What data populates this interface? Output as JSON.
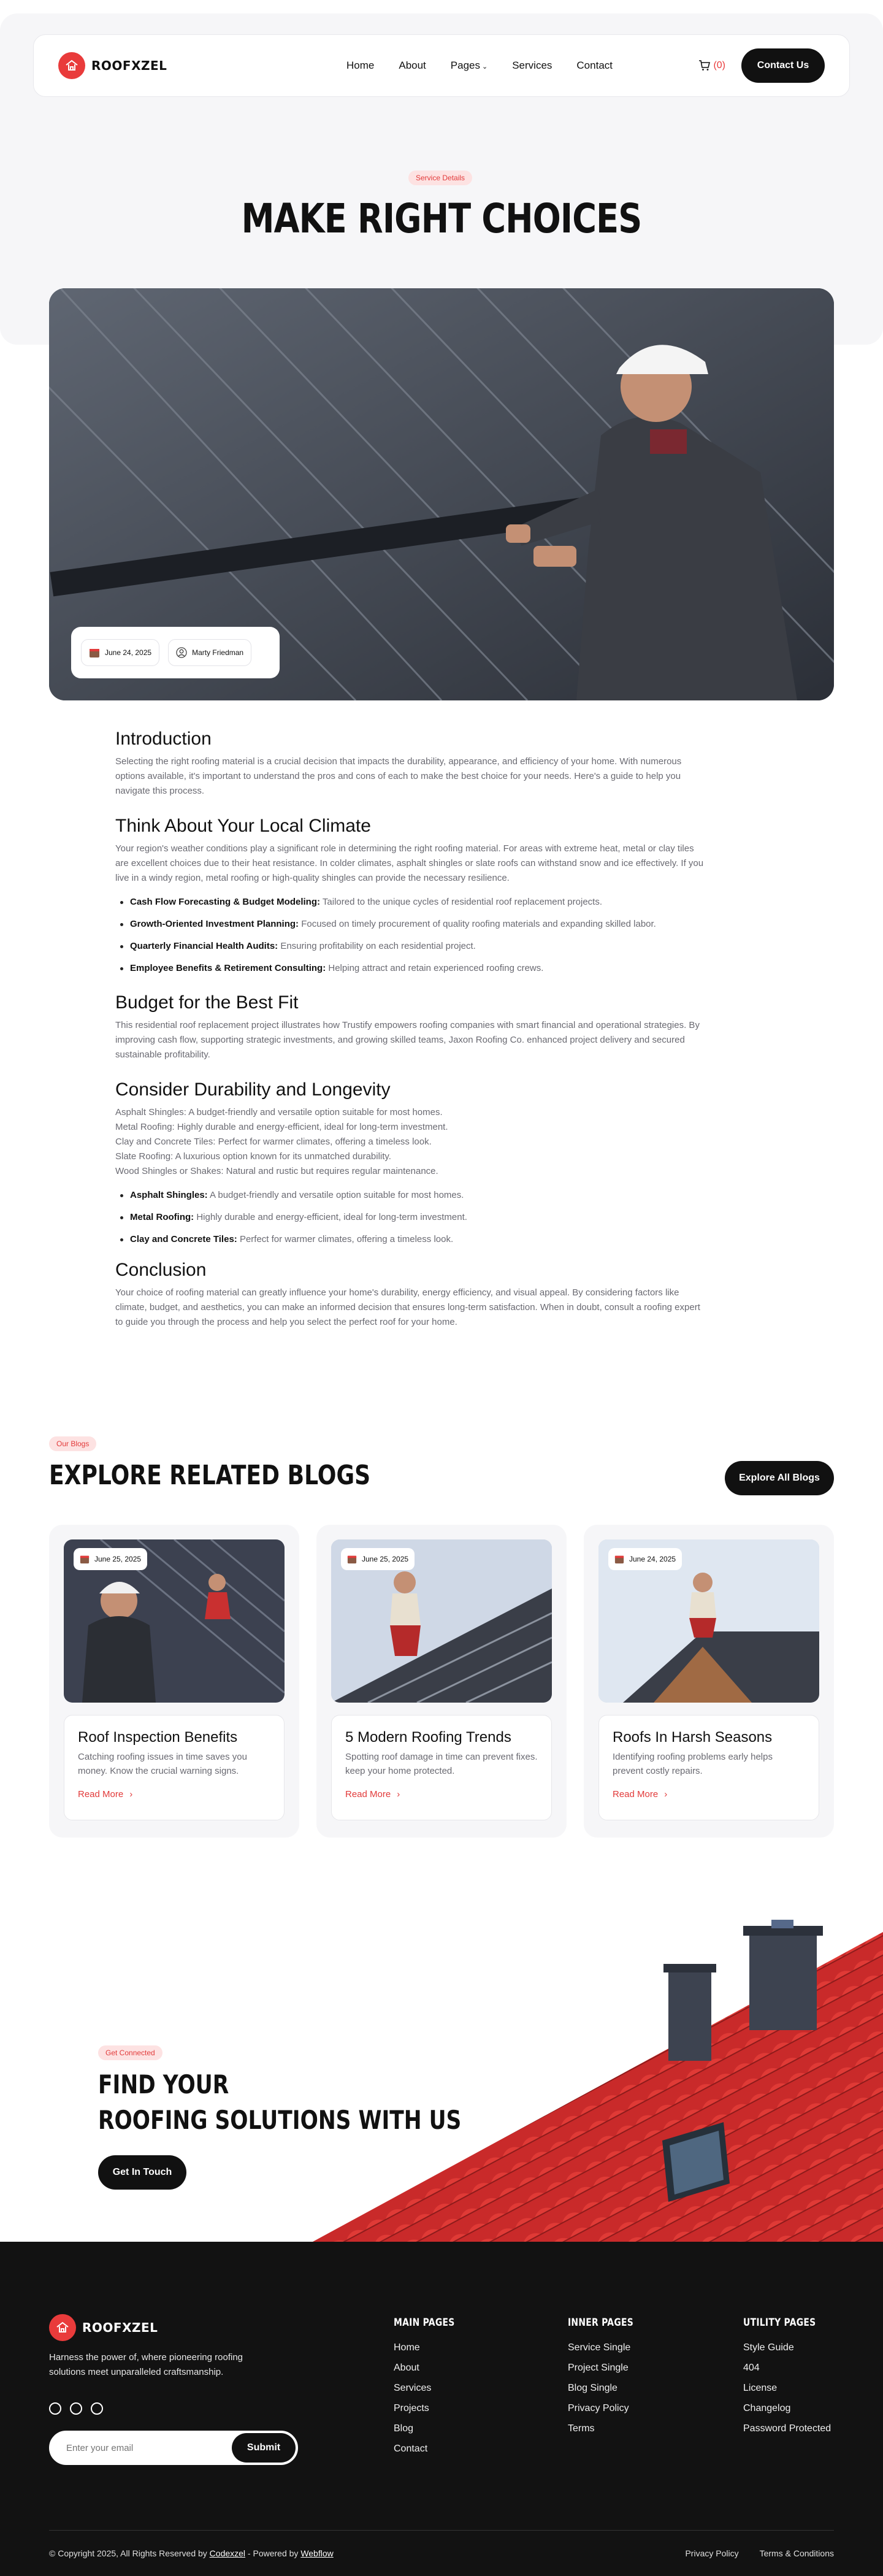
{
  "brand": {
    "name": "ROOFXZEL",
    "accent": "#e93b3b"
  },
  "nav": {
    "links": [
      "Home",
      "About",
      "Pages",
      "Services",
      "Contact"
    ],
    "cart_count": "(0)",
    "contact_label": "Contact Us"
  },
  "hero": {
    "pill": "Service Details",
    "title": "MAKE RIGHT CHOICES",
    "date": "June 24, 2025",
    "author": "Marty Friedman"
  },
  "article": {
    "intro_h": "Introduction",
    "intro_p": "Selecting the right roofing material is a crucial decision that impacts the durability, appearance, and efficiency of your home. With numerous options available, it's important to understand the pros and cons of each to make the best choice for your needs. Here's a guide to help you navigate this process.",
    "climate_h": "Think About Your Local Climate",
    "climate_p": "Your region's weather conditions play a significant role in determining the right roofing material. For areas with extreme heat, metal or clay tiles are excellent choices due to their heat resistance. In colder climates, asphalt shingles or slate roofs can withstand snow and ice effectively. If you live in a windy region, metal roofing or high-quality shingles can provide the necessary resilience.",
    "climate_list": [
      {
        "b": "Cash Flow Forecasting & Budget Modeling:",
        "t": " Tailored to the unique cycles of residential roof replacement projects."
      },
      {
        "b": "Growth-Oriented Investment Planning:",
        "t": " Focused on timely procurement of quality roofing materials and expanding skilled labor."
      },
      {
        "b": "Quarterly Financial Health Audits:",
        "t": " Ensuring profitability on each residential project."
      },
      {
        "b": "Employee Benefits & Retirement Consulting:",
        "t": " Helping attract and retain experienced roofing crews."
      }
    ],
    "budget_h": "Budget for the Best Fit",
    "budget_p": "This residential roof replacement project illustrates how Trustify empowers roofing companies with smart financial and operational strategies. By improving cash flow, supporting strategic investments, and growing skilled teams, Jaxon Roofing Co. enhanced project delivery and secured sustainable profitability.",
    "durability_h": "Consider Durability and Longevity",
    "durability_lines": [
      "Asphalt Shingles: A budget-friendly and versatile option suitable for most homes.",
      "Metal Roofing: Highly durable and energy-efficient, ideal for long-term investment.",
      "Clay and Concrete Tiles: Perfect for warmer climates, offering a timeless look.",
      "Slate Roofing: A luxurious option known for its unmatched durability.",
      "Wood Shingles or Shakes: Natural and rustic but requires regular maintenance."
    ],
    "durability_list": [
      {
        "b": "Asphalt Shingles:",
        "t": " A budget-friendly and versatile option suitable for most homes."
      },
      {
        "b": "Metal Roofing:",
        "t": " Highly durable and energy-efficient, ideal for long-term investment."
      },
      {
        "b": "Clay and Concrete Tiles:",
        "t": " Perfect for warmer climates, offering a timeless look."
      }
    ],
    "conclusion_h": "Conclusion",
    "conclusion_p": "Your choice of roofing material can greatly influence your home's durability, energy efficiency, and visual appeal. By considering factors like climate, budget, and aesthetics, you can make an informed decision that ensures long-term satisfaction. When in doubt, consult a roofing expert to guide you through the process and help you select the perfect roof for your home."
  },
  "blogs": {
    "pill": "Our Blogs",
    "title": "EXPLORE RELATED BLOGS",
    "all_label": "Explore All Blogs",
    "read_more": "Read More",
    "items": [
      {
        "date": "June 25, 2025",
        "title": "Roof Inspection Benefits",
        "desc": "Catching roofing issues in time saves you money. Know the crucial warning signs."
      },
      {
        "date": "June 25, 2025",
        "title": "5 Modern Roofing Trends",
        "desc": "Spotting roof damage in time can prevent fixes. keep your home protected."
      },
      {
        "date": "June 24, 2025",
        "title": "Roofs In Harsh Seasons",
        "desc": "Identifying roofing problems early helps prevent costly repairs."
      }
    ]
  },
  "cta": {
    "pill": "Get Connected",
    "line1": "FIND YOUR",
    "line2": "ROOFING SOLUTIONS WITH US",
    "button": "Get In Touch"
  },
  "footer": {
    "desc": "Harness the power of, where pioneering roofing solutions meet unparalleled craftsmanship.",
    "email_placeholder": "Enter your email",
    "submit": "Submit",
    "cols": [
      {
        "title": "MAIN PAGES",
        "items": [
          "Home",
          "About",
          "Services",
          "Projects",
          "Blog",
          "Contact"
        ]
      },
      {
        "title": "INNER PAGES",
        "items": [
          "Service Single",
          "Project Single",
          "Blog Single",
          "Privacy Policy",
          "Terms"
        ]
      },
      {
        "title": "UTILITY PAGES",
        "items": [
          "Style Guide",
          "404",
          "License",
          "Changelog",
          "Password Protected"
        ]
      }
    ],
    "copy_prefix": "© Copyright 2025, All Rights Reserved by ",
    "copy_brand": "Codexzel",
    "copy_mid": " - Powered by ",
    "copy_platform": "Webflow",
    "legal": [
      "Privacy Policy",
      "Terms & Conditions"
    ]
  }
}
